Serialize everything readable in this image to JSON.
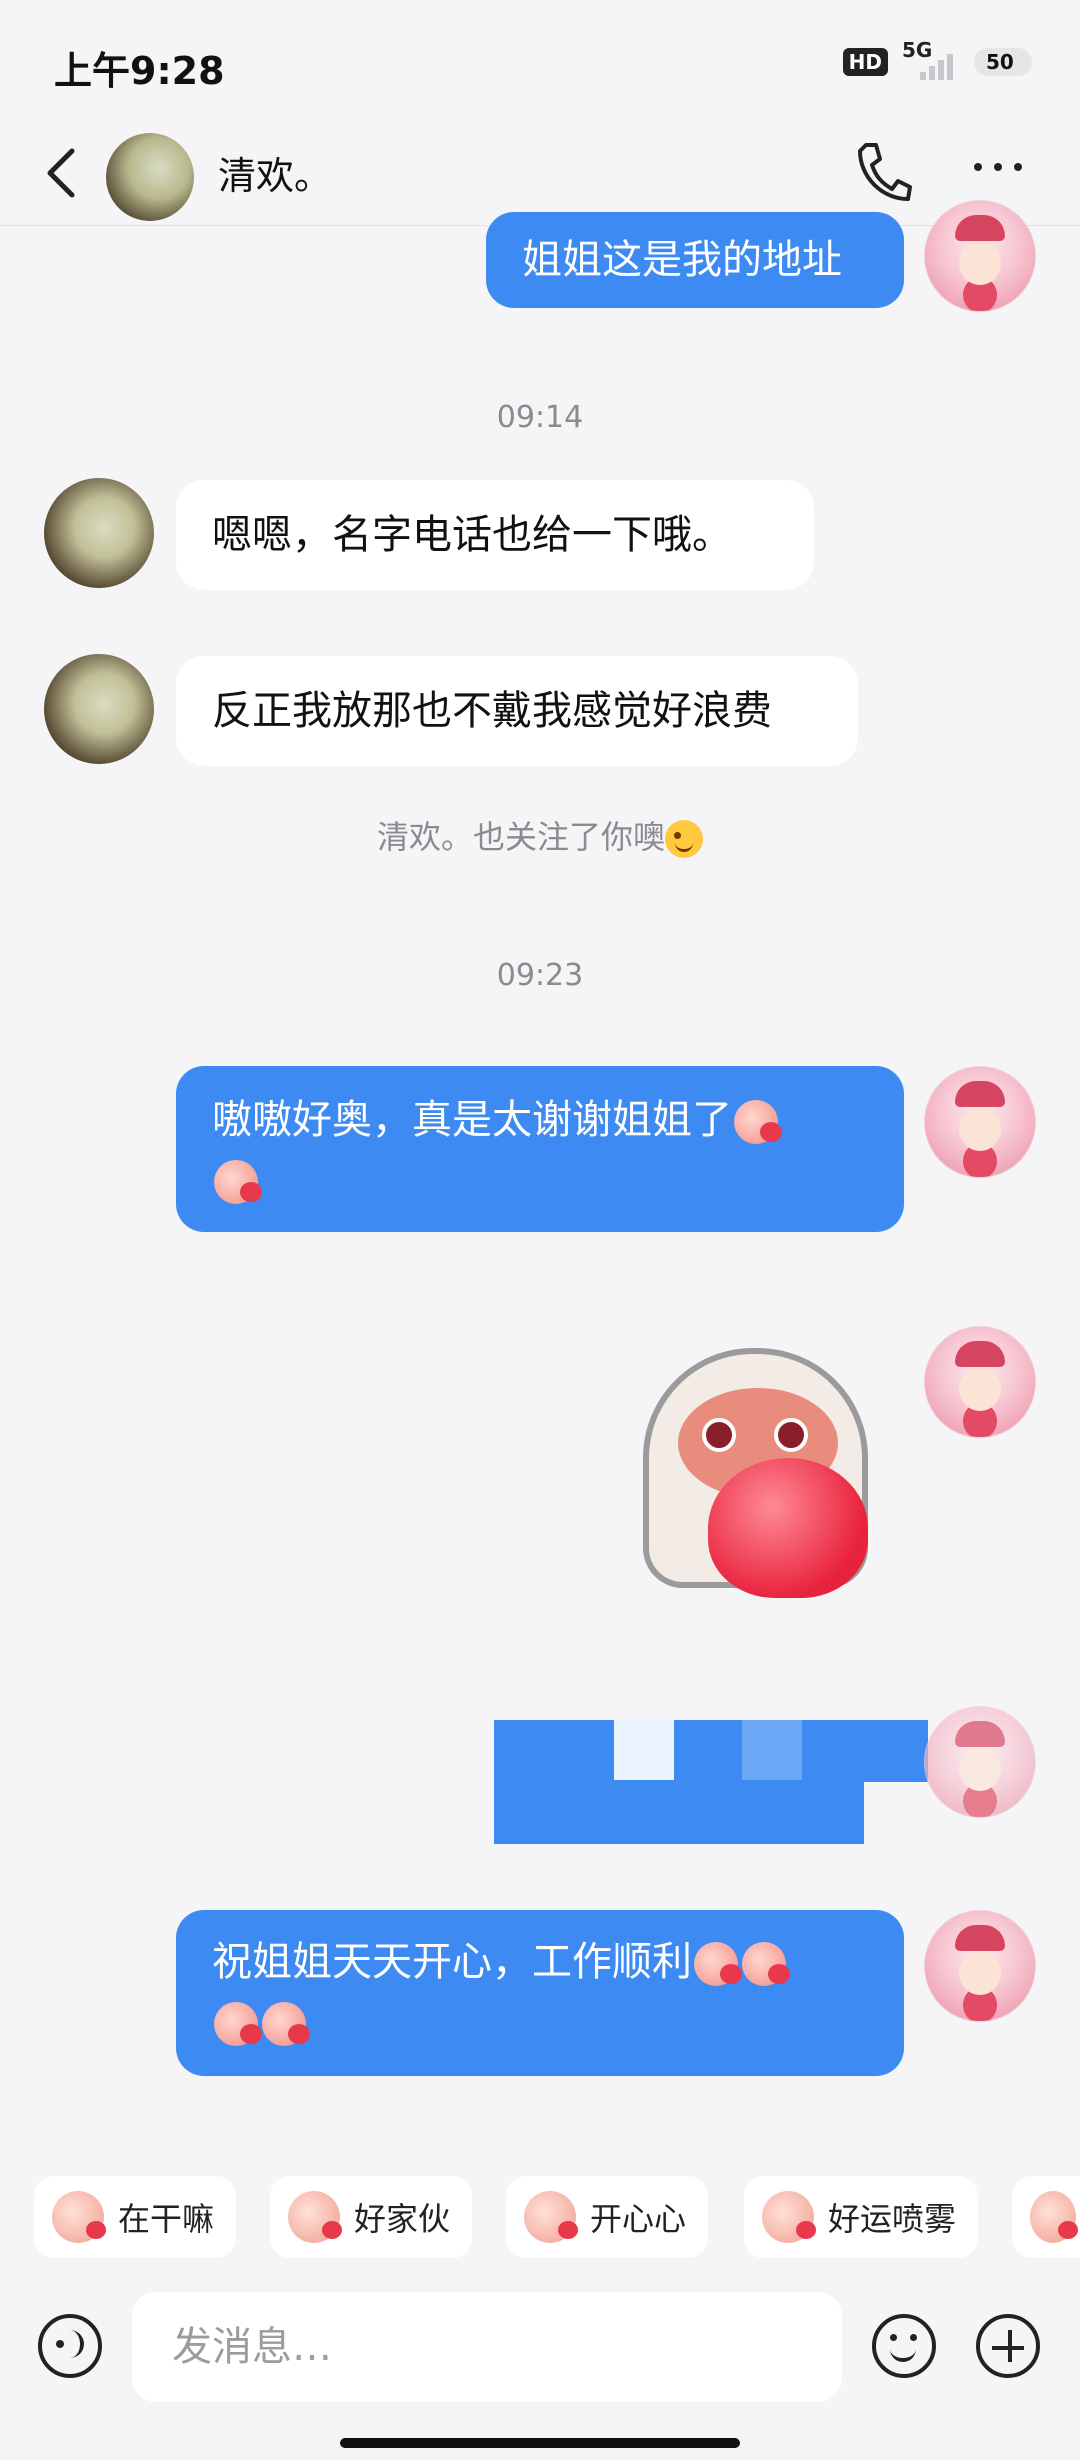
{
  "status_bar": {
    "time": "上午9:28",
    "hd": "HD",
    "network": "5G",
    "battery": "50"
  },
  "header": {
    "contact_name": "清欢。"
  },
  "messages": {
    "m1": "姐姐这是我的地址",
    "ts1": "09:14",
    "m2": "嗯嗯，名字电话也给一下哦。",
    "m3": "反正我放那也不戴我感觉好浪费",
    "sys": "清欢。也关注了你噢",
    "ts2": "09:23",
    "m4": "嗷嗷好奥，真是太谢谢姐姐了",
    "m6": "祝姐姐天天开心，工作顺利"
  },
  "quick_replies": [
    "在干嘛",
    "好家伙",
    "开心心",
    "好运喷雾"
  ],
  "input": {
    "placeholder": "发消息…"
  },
  "colors": {
    "outgoing_bubble": "#3d8bf2",
    "incoming_bubble": "#ffffff",
    "background": "#f5f5f7"
  }
}
